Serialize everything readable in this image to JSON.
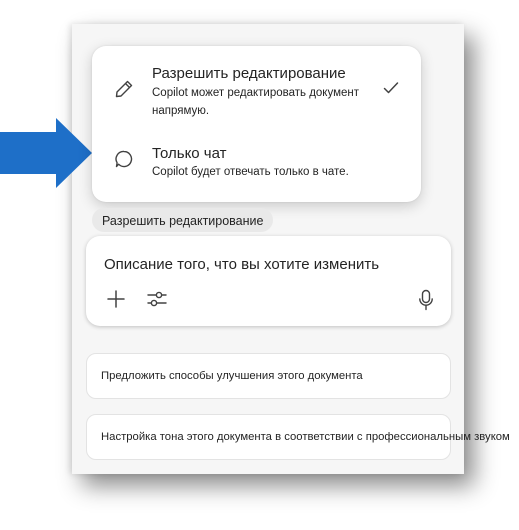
{
  "menu": {
    "items": [
      {
        "title": "Разрешить редактирование",
        "description": "Copilot может редактировать документ напрямую.",
        "icon": "pencil-icon",
        "selected": true
      },
      {
        "title": "Только чат",
        "description": "Copilot будет отвечать только в чате.",
        "icon": "chat-bubble-icon",
        "selected": false
      }
    ]
  },
  "mode_chip": {
    "label": "Разрешить редактирование"
  },
  "composer": {
    "placeholder": "Описание того, что вы хотите изменить",
    "tools": [
      "add-icon",
      "settings-sliders-icon",
      "microphone-icon"
    ]
  },
  "suggestions": [
    {
      "text": "Предложить способы улучшения этого документа"
    },
    {
      "text": "Настройка тона этого документа в соответствии с профессиональным звуком"
    }
  ],
  "colors": {
    "arrow": "#1e6fc8",
    "text": "#242424",
    "panel": "#f6f6f6"
  }
}
